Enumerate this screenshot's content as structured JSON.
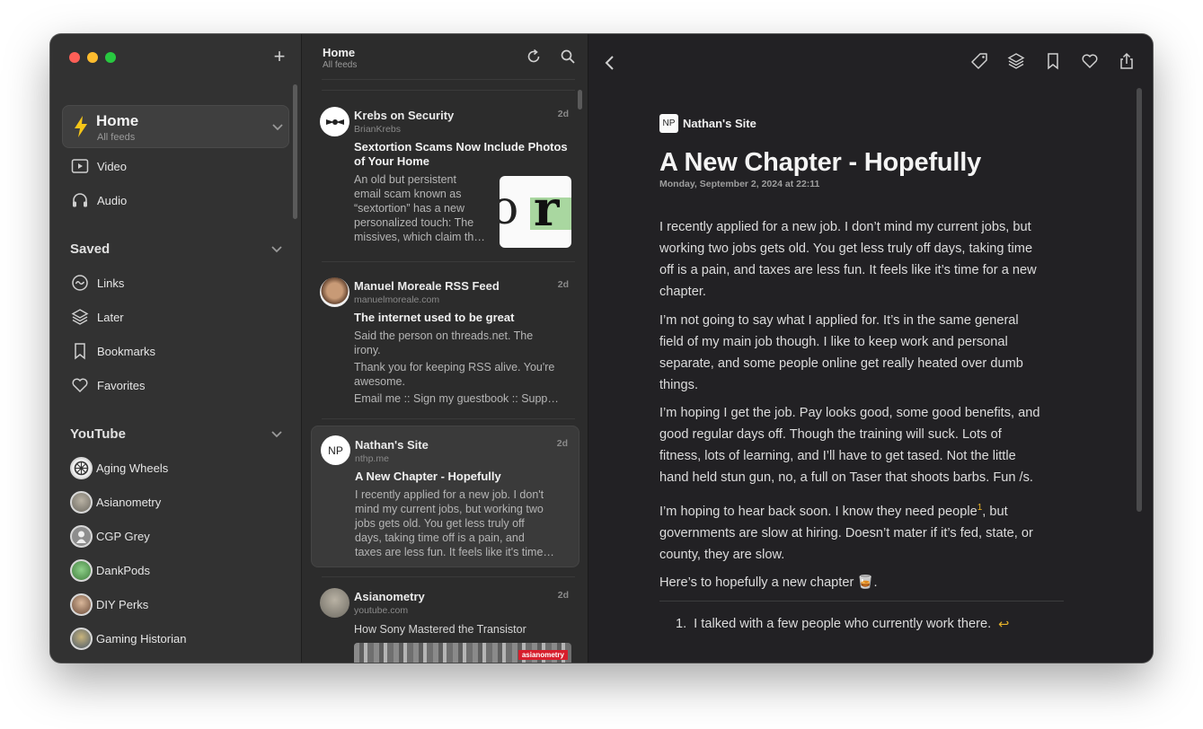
{
  "sidebar": {
    "home": {
      "title": "Home",
      "subtitle": "All feeds"
    },
    "items": [
      {
        "label": "Video",
        "icon": "video-icon"
      },
      {
        "label": "Audio",
        "icon": "headphones-icon"
      }
    ],
    "saved": {
      "heading": "Saved",
      "items": [
        {
          "label": "Links",
          "icon": "links-icon"
        },
        {
          "label": "Later",
          "icon": "layers-icon"
        },
        {
          "label": "Bookmarks",
          "icon": "bookmark-icon"
        },
        {
          "label": "Favorites",
          "icon": "heart-icon"
        }
      ]
    },
    "youtube": {
      "heading": "YouTube",
      "channels": [
        {
          "label": "Aging Wheels"
        },
        {
          "label": "Asianometry"
        },
        {
          "label": "CGP Grey"
        },
        {
          "label": "DankPods"
        },
        {
          "label": "DIY Perks"
        },
        {
          "label": "Gaming Historian"
        }
      ]
    }
  },
  "feed": {
    "title": "Home",
    "subtitle": "All feeds",
    "entries": [
      {
        "source": "Krebs on Security",
        "domain": "BrianKrebs",
        "age": "2d",
        "headline_1": "Sextortion Scams Now Include Photos",
        "headline_2": "of Your Home",
        "body": [
          "An old but persistent",
          "email scam known as",
          "“sextortion” has a new",
          "personalized touch: The",
          "missives, which claim th…"
        ]
      },
      {
        "source": "Manuel Moreale RSS Feed",
        "domain": "manuelmoreale.com",
        "age": "2d",
        "headline_1": "The internet used to be great",
        "body": [
          "Said the person on threads.net. The",
          "irony.",
          "Thank you for keeping RSS alive. You're",
          "awesome.",
          "Email me :: Sign my guestbook :: Supp…"
        ]
      },
      {
        "source": "Nathan's Site",
        "domain": "nthp.me",
        "age": "2d",
        "avatar_text": "NP",
        "headline_1": "A New Chapter - Hopefully",
        "body": [
          "I recently applied for a new job. I don't",
          "mind my current jobs, but working two",
          "jobs gets old. You get less truly off",
          "days, taking time off is a pain, and",
          "taxes are less fun. It feels like it's time…"
        ]
      },
      {
        "source": "Asianometry",
        "domain": "youtube.com",
        "age": "2d",
        "headline_1": "How Sony Mastered the Transistor",
        "badge": "asianometry"
      }
    ]
  },
  "article": {
    "site": "Nathan's Site",
    "site_logo": "NP",
    "title": "A New Chapter - Hopefully",
    "date": "Monday, September 2, 2024 at 22:11",
    "p1": [
      "I recently applied for a new job. I don’t mind my current jobs, but",
      "working two jobs gets old. You get less truly off days, taking time",
      "off is a pain, and taxes are less fun. It feels like it’s time for a new",
      "chapter."
    ],
    "p2": [
      "I’m not going to say what I applied for. It’s in the same general",
      "field of my main job though. I like to keep work and personal",
      "separate, and some people online get really heated over dumb",
      "things."
    ],
    "p3": [
      "I’m hoping I get the job. Pay looks good, some good benefits, and",
      "good regular days off. Though the training will suck. Lots of",
      "fitness, lots of learning, and I’ll have to get tased. Not the little",
      "hand held stun gun, no, a full on Taser that shoots barbs. Fun /s."
    ],
    "p4_a": "I’m hoping to hear back soon. I know they need people",
    "p4_sup": "1",
    "p4_b": ", but",
    "p4_rest": [
      "governments are slow at hiring. Doesn’t mater if it’s fed, state, or",
      "county, they are slow."
    ],
    "p5": "Here’s to hopefully a new chapter 🥃.",
    "footnote_num": "1.",
    "footnote": "I talked with a few people who currently work there.",
    "footnote_back": "↩"
  },
  "colors": {
    "accent": "#e7b32a",
    "bolt": "#f5c518"
  }
}
